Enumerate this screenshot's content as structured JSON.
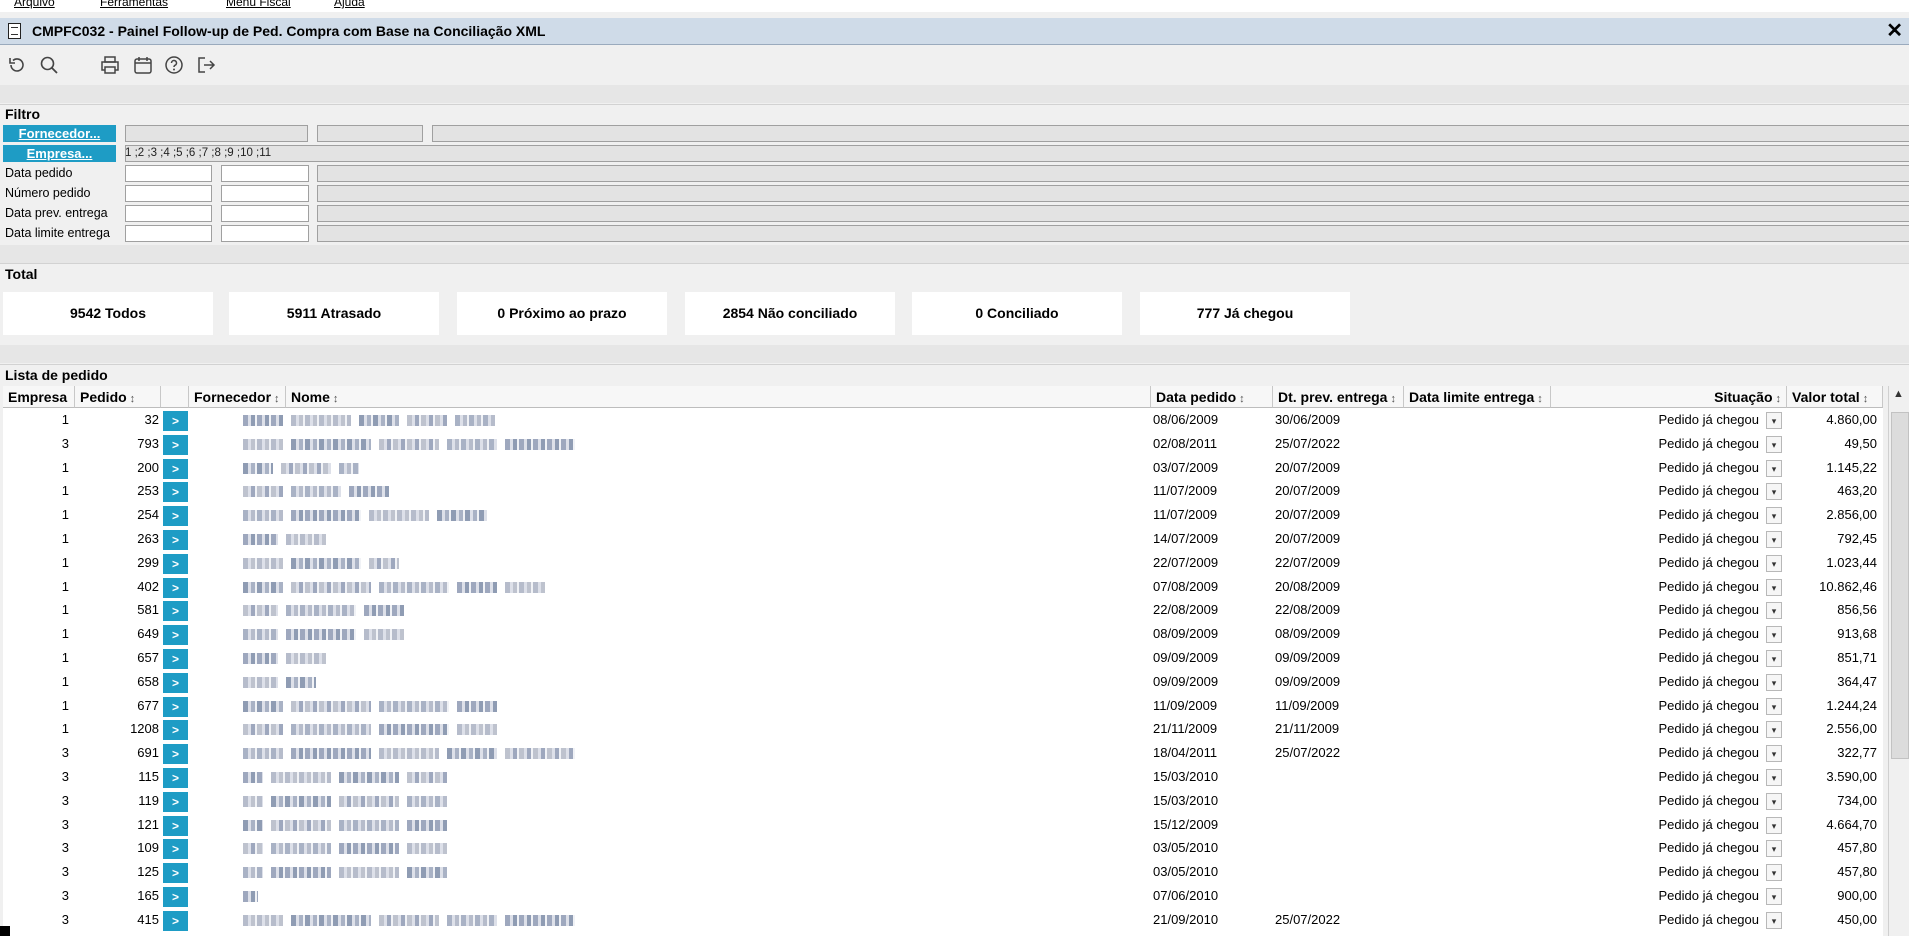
{
  "menu": [
    "Arquivo",
    "Ferramentas",
    "Menu Fiscal",
    "Ajuda"
  ],
  "window": {
    "title": "CMPFC032 - Painel Follow-up de Ped. Compra com Base na Conciliação XML",
    "close": "✕"
  },
  "toolbar": [
    "refresh-icon",
    "search-icon",
    "print-icon",
    "calendar-icon",
    "help-icon",
    "exit-icon"
  ],
  "filtro": {
    "title": "Filtro",
    "fornecedor_btn": "Fornecedor...",
    "empresa_btn": "Empresa...",
    "empresa_values": "1 ;2 ;3 ;4 ;5 ;6 ;7 ;8 ;9 ;10 ;11",
    "labels": [
      "Data pedido",
      "Número pedido",
      "Data prev. entrega",
      "Data limite entrega"
    ]
  },
  "total": {
    "title": "Total",
    "boxes": [
      "9542 Todos",
      "5911 Atrasado",
      "0 Próximo ao prazo",
      "2854 Não conciliado",
      "0 Conciliado",
      "777 Já chegou"
    ]
  },
  "lista": {
    "title": "Lista de pedido",
    "headers": {
      "empresa": "Empresa",
      "pedido": "Pedido",
      "fornecedor": "Fornecedor",
      "nome": "Nome",
      "data_pedido": "Data pedido",
      "dt_prev": "Dt. prev. entrega",
      "data_limite": "Data limite entrega",
      "situacao": "Situação",
      "valor": "Valor total"
    },
    "go_label": ">",
    "rows": [
      {
        "empresa": "1",
        "pedido": "32",
        "data": "08/06/2009",
        "prev": "30/06/2009",
        "sit": "Pedido já chegou",
        "valor": "4.860,00",
        "w": [
          40,
          60,
          40,
          40,
          40
        ]
      },
      {
        "empresa": "3",
        "pedido": "793",
        "data": "02/08/2011",
        "prev": "25/07/2022",
        "sit": "Pedido já chegou",
        "valor": "49,50",
        "w": [
          40,
          80,
          60,
          50,
          70
        ]
      },
      {
        "empresa": "1",
        "pedido": "200",
        "data": "03/07/2009",
        "prev": "20/07/2009",
        "sit": "Pedido já chegou",
        "valor": "1.145,22",
        "w": [
          30,
          50,
          20
        ]
      },
      {
        "empresa": "1",
        "pedido": "253",
        "data": "11/07/2009",
        "prev": "20/07/2009",
        "sit": "Pedido já chegou",
        "valor": "463,20",
        "w": [
          40,
          50,
          40
        ]
      },
      {
        "empresa": "1",
        "pedido": "254",
        "data": "11/07/2009",
        "prev": "20/07/2009",
        "sit": "Pedido já chegou",
        "valor": "2.856,00",
        "w": [
          40,
          70,
          60,
          50
        ]
      },
      {
        "empresa": "1",
        "pedido": "263",
        "data": "14/07/2009",
        "prev": "20/07/2009",
        "sit": "Pedido já chegou",
        "valor": "792,45",
        "w": [
          35,
          40
        ]
      },
      {
        "empresa": "1",
        "pedido": "299",
        "data": "22/07/2009",
        "prev": "22/07/2009",
        "sit": "Pedido já chegou",
        "valor": "1.023,44",
        "w": [
          40,
          70,
          30
        ]
      },
      {
        "empresa": "1",
        "pedido": "402",
        "data": "07/08/2009",
        "prev": "20/08/2009",
        "sit": "Pedido já chegou",
        "valor": "10.862,46",
        "w": [
          40,
          80,
          70,
          40,
          40
        ]
      },
      {
        "empresa": "1",
        "pedido": "581",
        "data": "22/08/2009",
        "prev": "22/08/2009",
        "sit": "Pedido já chegou",
        "valor": "856,56",
        "w": [
          35,
          70,
          40
        ]
      },
      {
        "empresa": "1",
        "pedido": "649",
        "data": "08/09/2009",
        "prev": "08/09/2009",
        "sit": "Pedido já chegou",
        "valor": "913,68",
        "w": [
          35,
          70,
          40
        ]
      },
      {
        "empresa": "1",
        "pedido": "657",
        "data": "09/09/2009",
        "prev": "09/09/2009",
        "sit": "Pedido já chegou",
        "valor": "851,71",
        "w": [
          35,
          40
        ]
      },
      {
        "empresa": "1",
        "pedido": "658",
        "data": "09/09/2009",
        "prev": "09/09/2009",
        "sit": "Pedido já chegou",
        "valor": "364,47",
        "w": [
          35,
          30
        ]
      },
      {
        "empresa": "1",
        "pedido": "677",
        "data": "11/09/2009",
        "prev": "11/09/2009",
        "sit": "Pedido já chegou",
        "valor": "1.244,24",
        "w": [
          40,
          80,
          70,
          40
        ]
      },
      {
        "empresa": "1",
        "pedido": "1208",
        "data": "21/11/2009",
        "prev": "21/11/2009",
        "sit": "Pedido já chegou",
        "valor": "2.556,00",
        "w": [
          40,
          80,
          70,
          40
        ]
      },
      {
        "empresa": "3",
        "pedido": "691",
        "data": "18/04/2011",
        "prev": "25/07/2022",
        "sit": "Pedido já chegou",
        "valor": "322,77",
        "w": [
          40,
          80,
          60,
          50,
          70
        ]
      },
      {
        "empresa": "3",
        "pedido": "115",
        "data": "15/03/2010",
        "prev": "",
        "sit": "Pedido já chegou",
        "valor": "3.590,00",
        "w": [
          20,
          60,
          60,
          40
        ]
      },
      {
        "empresa": "3",
        "pedido": "119",
        "data": "15/03/2010",
        "prev": "",
        "sit": "Pedido já chegou",
        "valor": "734,00",
        "w": [
          20,
          60,
          60,
          40
        ]
      },
      {
        "empresa": "3",
        "pedido": "121",
        "data": "15/12/2009",
        "prev": "",
        "sit": "Pedido já chegou",
        "valor": "4.664,70",
        "w": [
          20,
          60,
          60,
          40
        ]
      },
      {
        "empresa": "3",
        "pedido": "109",
        "data": "03/05/2010",
        "prev": "",
        "sit": "Pedido já chegou",
        "valor": "457,80",
        "w": [
          20,
          60,
          60,
          40
        ]
      },
      {
        "empresa": "3",
        "pedido": "125",
        "data": "03/05/2010",
        "prev": "",
        "sit": "Pedido já chegou",
        "valor": "457,80",
        "w": [
          20,
          60,
          60,
          40
        ]
      },
      {
        "empresa": "3",
        "pedido": "165",
        "data": "07/06/2010",
        "prev": "",
        "sit": "Pedido já chegou",
        "valor": "900,00",
        "w": [
          15
        ]
      },
      {
        "empresa": "3",
        "pedido": "415",
        "data": "21/09/2010",
        "prev": "25/07/2022",
        "sit": "Pedido já chegou",
        "valor": "450,00",
        "w": [
          40,
          80,
          60,
          50,
          70
        ]
      }
    ]
  }
}
